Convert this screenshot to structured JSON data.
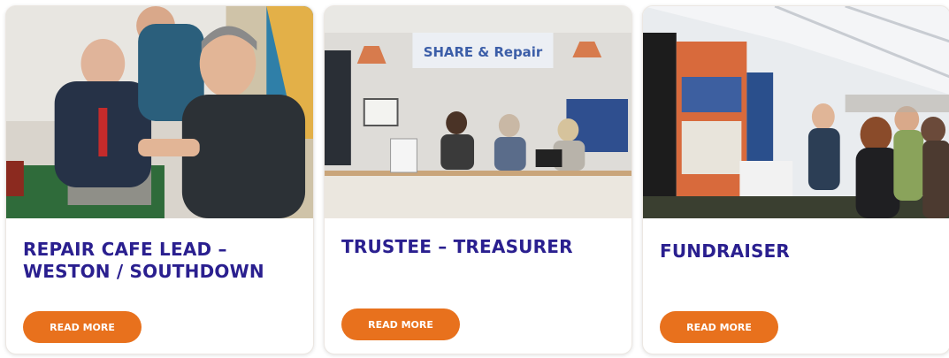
{
  "colors": {
    "title": "#2a1f8f",
    "button": "#e8711d",
    "button_text": "#ffffff"
  },
  "cards": [
    {
      "title": "REPAIR CAFE LEAD – WESTON / SOUTHDOWN",
      "button_label": "READ MORE",
      "image": "people-repairing-photo"
    },
    {
      "title": "TRUSTEE – TREASURER",
      "button_label": "READ MORE",
      "image": "share-and-repair-counter-photo",
      "photo_sign": "SHARE & Repair"
    },
    {
      "title": "FUNDRAISER",
      "button_label": "READ MORE",
      "image": "event-marquee-crowd-photo"
    }
  ]
}
